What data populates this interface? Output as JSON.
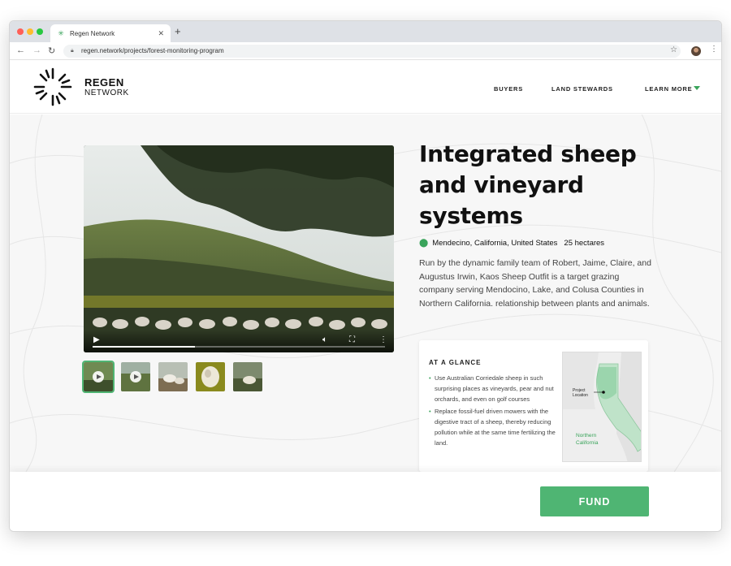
{
  "browser": {
    "tab_title": "Regen Network",
    "new_tab_symbol": "+",
    "url": "regen.network/projects/forest-monitoring-program",
    "icons": [
      "back-icon",
      "forward-icon",
      "reload-icon",
      "lock-icon",
      "star-icon",
      "profile-avatar",
      "menu-kebab-icon"
    ]
  },
  "header": {
    "logo_line1": "REGEN",
    "logo_line2": "NETWORK",
    "nav": [
      "BUYERS",
      "LAND STEWARDS",
      "LEARN MORE"
    ]
  },
  "project": {
    "title": "Integrated sheep and vineyard systems",
    "location": "Mendecino, California, United States",
    "area": "25 hectares",
    "description": "Run by the dynamic family team of Robert, Jaime, Claire, and Augustus Irwin, Kaos Sheep Outfit is a target grazing company serving Mendocino, Lake, and Colusa Counties in Northern California. relationship between plants and animals."
  },
  "video": {
    "progress": 0.35,
    "controls": [
      "play-icon",
      "volume-icon",
      "fullscreen-icon",
      "more-icon"
    ]
  },
  "gallery": {
    "selected_index": 0,
    "count": 5
  },
  "glance": {
    "heading": "AT A GLANCE",
    "bullets": [
      "Use Australian Corriedale sheep in such surprising places as vineyards, pear and nut orchards, and even on golf courses",
      "Replace fossil-fuel driven mowers with the digestive tract of a sheep, thereby reducing pollution while at the same time fertilizing the land."
    ],
    "map_project_label": "Project Location",
    "map_region_label": "Northern California"
  },
  "footer": {
    "fund_label": "FUND"
  },
  "colors": {
    "accent": "#4fb573",
    "text": "#111111"
  }
}
